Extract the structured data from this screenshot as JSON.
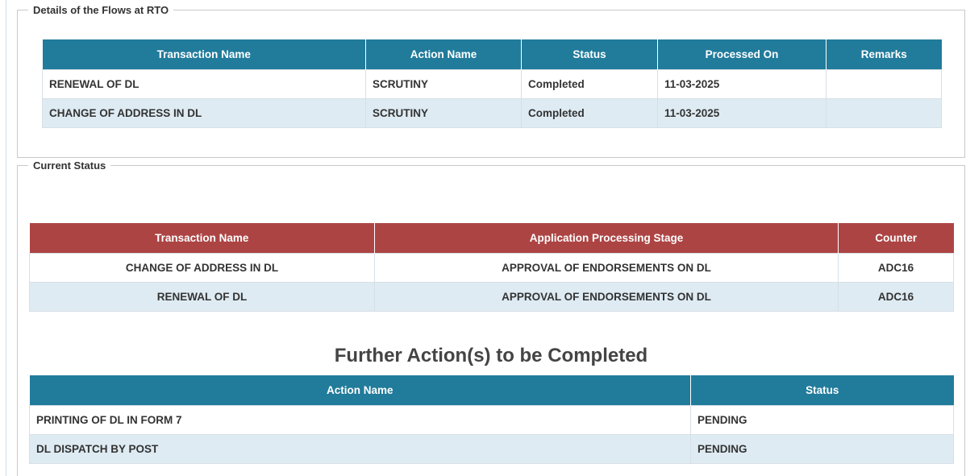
{
  "flows_section": {
    "legend": "Details of the Flows at RTO",
    "headers": [
      "Transaction Name",
      "Action Name",
      "Status",
      "Processed On",
      "Remarks"
    ],
    "rows": [
      [
        "RENEWAL OF DL",
        "SCRUTINY",
        "Completed",
        "11-03-2025",
        ""
      ],
      [
        "CHANGE OF ADDRESS IN DL",
        "SCRUTINY",
        "Completed",
        "11-03-2025",
        ""
      ]
    ]
  },
  "current_status": {
    "legend": "Current Status",
    "headers": [
      "Transaction Name",
      "Application Processing Stage",
      "Counter"
    ],
    "rows": [
      [
        "CHANGE OF ADDRESS IN DL",
        "APPROVAL OF ENDORSEMENTS ON DL",
        "ADC16"
      ],
      [
        "RENEWAL OF DL",
        "APPROVAL OF ENDORSEMENTS ON DL",
        "ADC16"
      ]
    ]
  },
  "further_actions": {
    "title": "Further Action(s) to be Completed",
    "headers": [
      "Action Name",
      "Status"
    ],
    "rows": [
      [
        "PRINTING OF DL IN FORM 7",
        "PENDING"
      ],
      [
        "DL DISPATCH BY POST",
        "PENDING"
      ]
    ]
  },
  "colors": {
    "teal_header": "#217b9b",
    "red_header": "#ad4444",
    "alt_row": "#deebf3"
  }
}
